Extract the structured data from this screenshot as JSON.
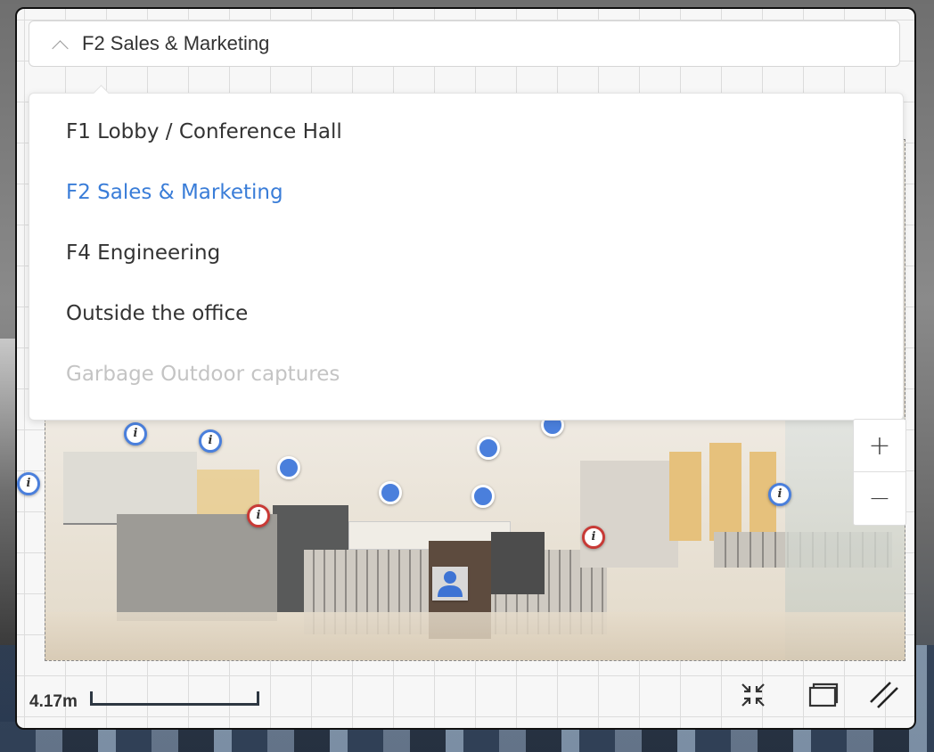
{
  "floor_selector": {
    "selected_label": "F2 Sales & Marketing",
    "options": [
      {
        "label": "F1 Lobby / Conference Hall",
        "state": "normal"
      },
      {
        "label": "F2 Sales & Marketing",
        "state": "selected"
      },
      {
        "label": "F4 Engineering",
        "state": "normal"
      },
      {
        "label": "Outside the office",
        "state": "normal"
      },
      {
        "label": "Garbage Outdoor captures",
        "state": "disabled"
      }
    ]
  },
  "zoom": {
    "in_label": "+",
    "out_label": "−"
  },
  "scale": {
    "label": "4.17m"
  },
  "colors": {
    "accent": "#3a7dd8",
    "pin_blue": "#4a7fdc",
    "pin_red": "#c83a36",
    "disabled_text": "#c4c4c4"
  },
  "icons": {
    "selector_toggle": "chevron-up-icon",
    "info_pin": "info-icon",
    "person_marker": "person-icon",
    "collapse": "collapse-icon",
    "layers": "layers-icon",
    "measure": "measure-icon"
  }
}
